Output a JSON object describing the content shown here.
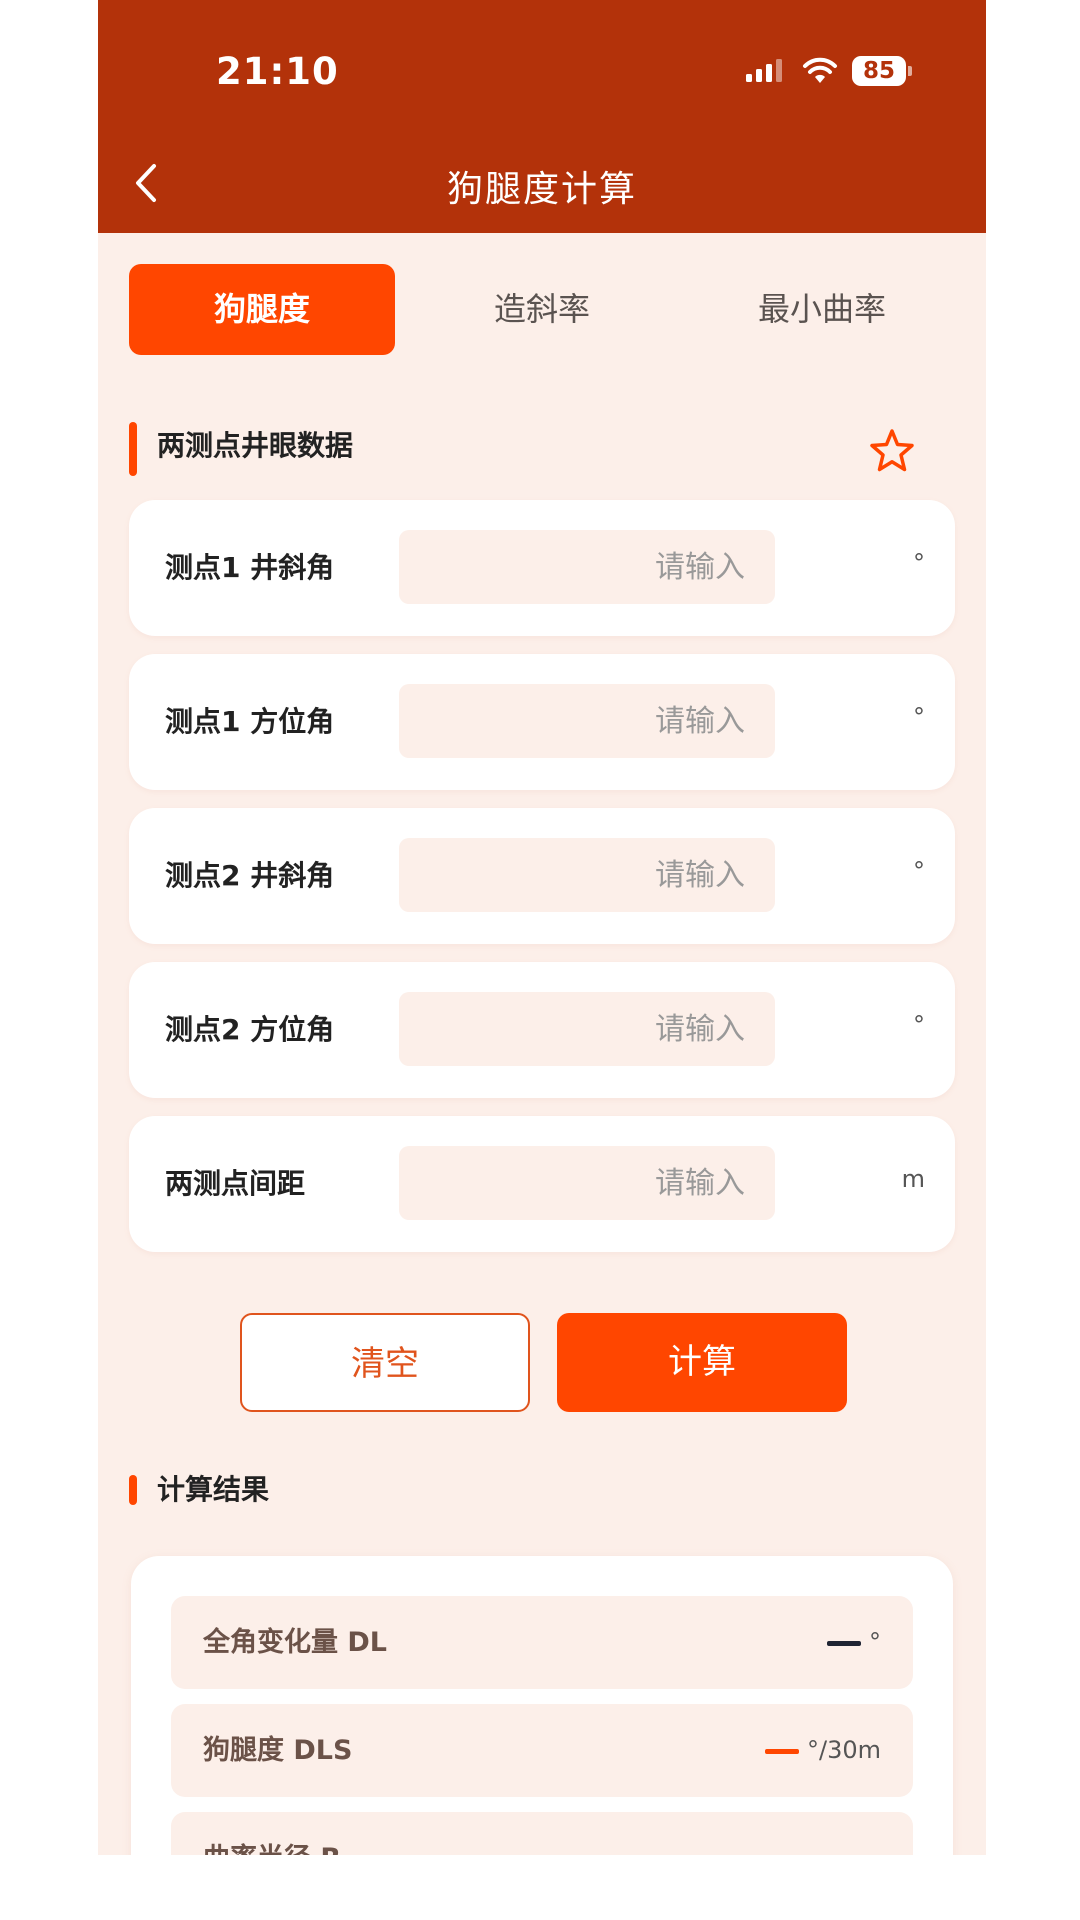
{
  "status_bar": {
    "time": "21:10",
    "battery": "85"
  },
  "nav": {
    "title": "狗腿度计算"
  },
  "tabs": [
    {
      "label": "狗腿度",
      "active": true
    },
    {
      "label": "造斜率",
      "active": false
    },
    {
      "label": "最小曲率",
      "active": false
    }
  ],
  "input_section": {
    "title": "两测点井眼数据",
    "fields": [
      {
        "label": "测点1 井斜角",
        "placeholder": "请输入",
        "unit": "°"
      },
      {
        "label": "测点1 方位角",
        "placeholder": "请输入",
        "unit": "°"
      },
      {
        "label": "测点2 井斜角",
        "placeholder": "请输入",
        "unit": "°"
      },
      {
        "label": "测点2 方位角",
        "placeholder": "请输入",
        "unit": "°"
      },
      {
        "label": "两测点间距",
        "placeholder": "请输入",
        "unit": "m"
      }
    ]
  },
  "buttons": {
    "clear": "清空",
    "calculate": "计算"
  },
  "result_section": {
    "title": "计算结果",
    "rows": [
      {
        "label": "全角变化量 DL",
        "unit": "°",
        "dash_color": "#1f2433"
      },
      {
        "label": "狗腿度 DLS",
        "unit": "°/30m",
        "dash_color": "#ff4600"
      },
      {
        "label": "曲率半径 R",
        "unit": "",
        "dash_color": "#ff4600"
      }
    ]
  },
  "colors": {
    "header": "#b3320a",
    "accent": "#ff4600",
    "background": "#fcefe9"
  }
}
